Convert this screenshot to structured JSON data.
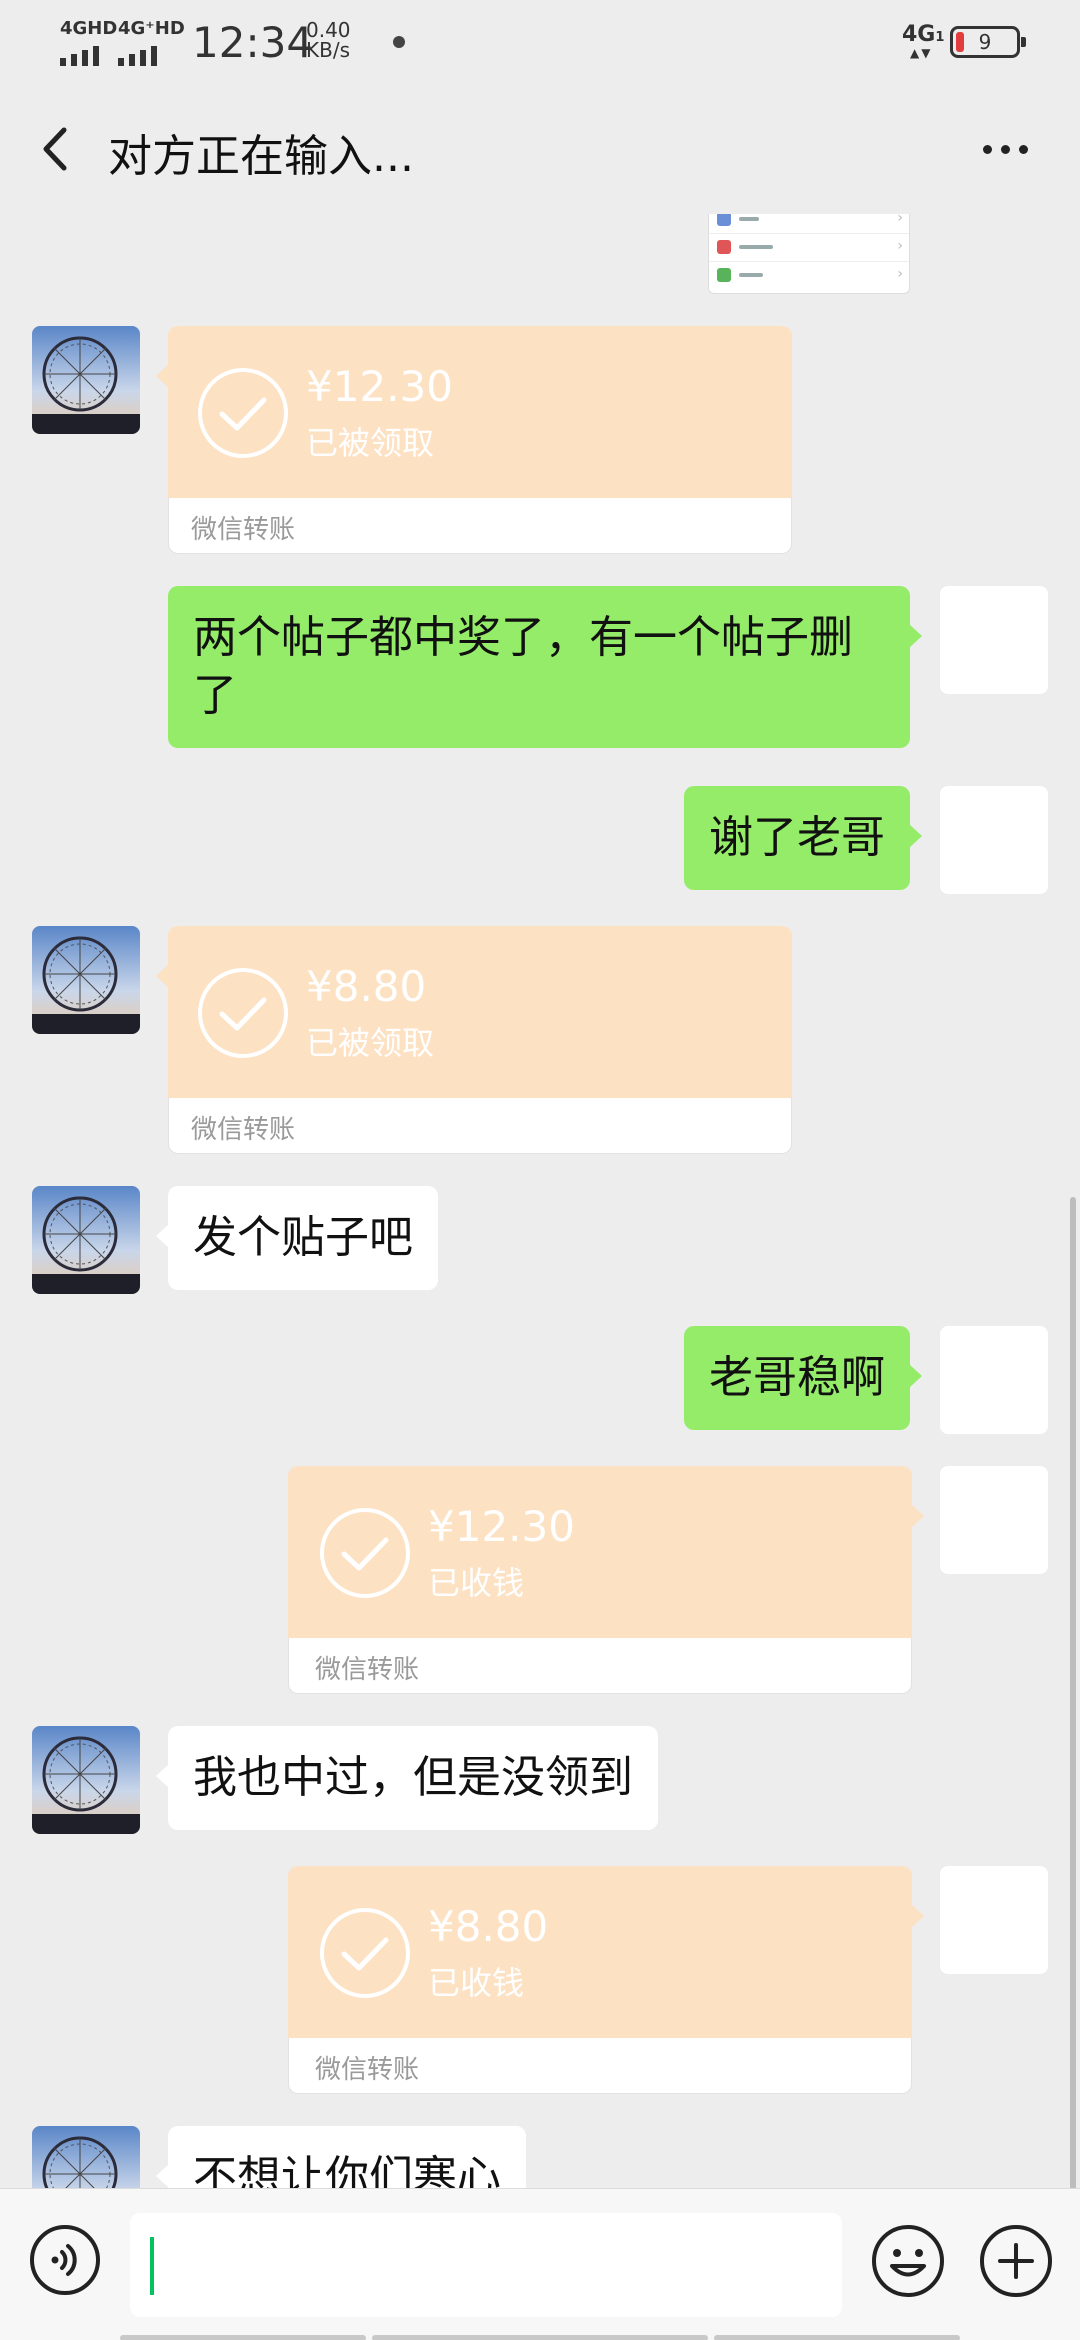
{
  "status_bar": {
    "network_1": "4GHD",
    "network_2": "4G⁺HD",
    "time": "12:34",
    "speed_value": "0.40",
    "speed_unit": "KB/s",
    "network_right": "4G",
    "network_right_sub": "1",
    "battery": "9"
  },
  "header": {
    "title": "对方正在输入..."
  },
  "screenshot_thumbnail": {
    "rows": [
      "",
      "",
      ""
    ]
  },
  "messages": [
    {
      "type": "transfer",
      "side": "left",
      "amount": "¥12.30",
      "status": "已被领取",
      "label": "微信转账"
    },
    {
      "type": "text",
      "side": "right",
      "text": "两个帖子都中奖了，有一个帖子删了"
    },
    {
      "type": "text",
      "side": "right",
      "text": "谢了老哥"
    },
    {
      "type": "transfer",
      "side": "left",
      "amount": "¥8.80",
      "status": "已被领取",
      "label": "微信转账"
    },
    {
      "type": "text",
      "side": "left",
      "text": "发个贴子吧"
    },
    {
      "type": "text",
      "side": "right",
      "text": "老哥稳啊"
    },
    {
      "type": "transfer",
      "side": "right",
      "amount": "¥12.30",
      "status": "已收钱",
      "label": "微信转账"
    },
    {
      "type": "text",
      "side": "left",
      "text": "我也中过，但是没领到"
    },
    {
      "type": "transfer",
      "side": "right",
      "amount": "¥8.80",
      "status": "已收钱",
      "label": "微信转账"
    },
    {
      "type": "text",
      "side": "left",
      "text": "不想让你们寒心"
    }
  ],
  "input_bar": {
    "value": "",
    "placeholder": ""
  },
  "icons": {
    "back": "chevron-left-icon",
    "more": "more-dots-icon",
    "voice": "voice-icon",
    "emoji": "emoji-icon",
    "plus": "plus-icon",
    "transfer_done": "check-circle-icon"
  },
  "colors": {
    "background": "#ededed",
    "self_bubble": "#95ec69",
    "other_bubble": "#ffffff",
    "transfer_card": "#fde1c3",
    "caret": "#07c160",
    "battery_low": "#e23c3c"
  }
}
